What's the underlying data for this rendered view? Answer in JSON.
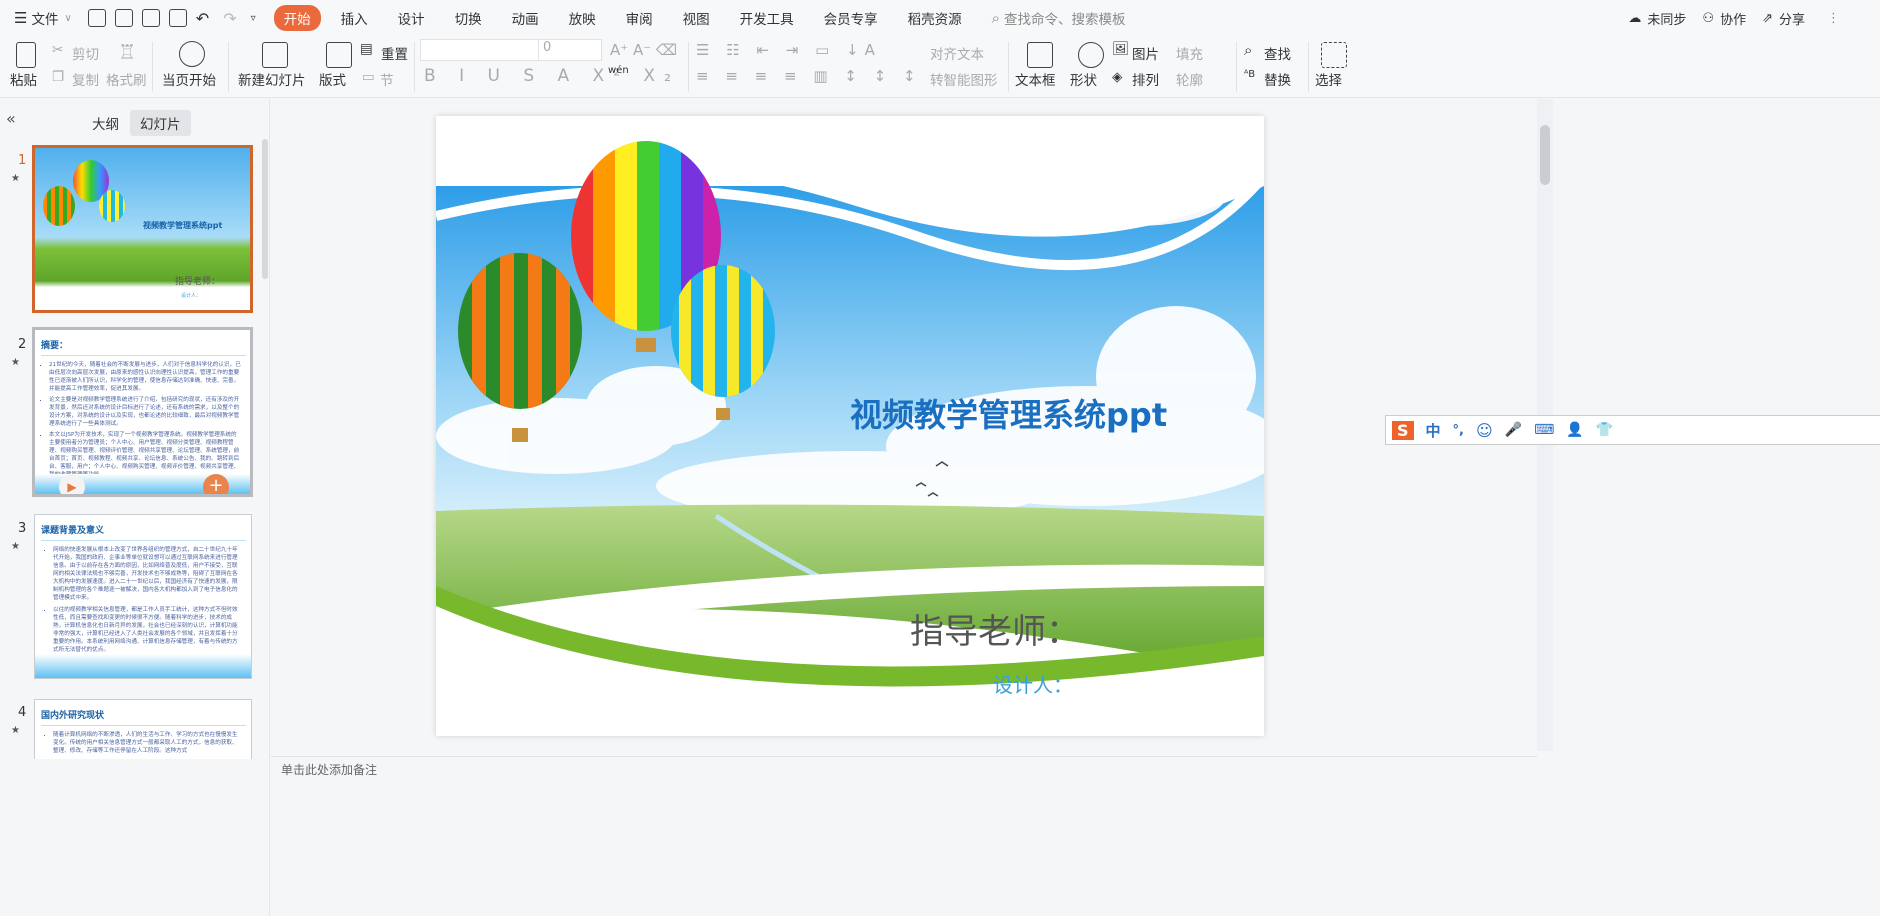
{
  "titlebar": {
    "file_menu": "文件",
    "tabs": [
      "开始",
      "插入",
      "设计",
      "切换",
      "动画",
      "放映",
      "审阅",
      "视图",
      "开发工具",
      "会员专享",
      "稻壳资源"
    ],
    "active_tab": "开始",
    "search_placeholder": "查找命令、搜索模板",
    "sync": "未同步",
    "collab": "协作",
    "share": "分享"
  },
  "ribbon": {
    "paste": "粘贴",
    "cut": "剪切",
    "copy": "复制",
    "format_painter": "格式刷",
    "play_from_current": "当页开始",
    "new_slide": "新建幻灯片",
    "layout": "版式",
    "reset": "重置",
    "section": "节",
    "font_name": "",
    "font_size": "0",
    "align_text": "对齐文本",
    "smart_art": "转智能图形",
    "textbox": "文本框",
    "shape": "形状",
    "picture": "图片",
    "fill": "填充",
    "arrange": "排列",
    "outline": "轮廓",
    "find": "查找",
    "replace": "替换",
    "select": "选择",
    "pinyin": "wén"
  },
  "panel": {
    "tab_outline": "大纲",
    "tab_slides": "幻灯片",
    "active": "幻灯片"
  },
  "thumbnails": [
    {
      "num": "1",
      "title": "视频教学管理系统ppt",
      "teacher": "指导老师：",
      "designer": "设计人："
    },
    {
      "num": "2",
      "title": "摘要：",
      "bullets": [
        "21世纪的今天，随着社会的不断发展与进步，人们对于信息科学化的认识，已由低层次向高层次发展，由原来的感性认识向理性认识提高，管理工作的重要性已逐渐被人们所认识，科学化的管理，使信息存储达到准确、快速、完善，并能提高工作管理效率，促进其发展。",
        "论文主要是对视频教学管理系统进行了介绍，包括研究的现状，还有涉及的开发背景，然后还对系统的设计目标进行了论述，还有系统的需求，以及整个的设计方案，对系统的设计以及实现，也都论述的比较细致，最后对视频教学管理系统进行了一些具体测试。",
        "本文以JSP为开发技术，实现了一个视频教学管理系统。视频教学管理系统的主要使用者分为管理员；个人中心、用户管理、视频分类管理、视频教程管理、视频购买管理、视频评价管理、视频共享管理、论坛管理、系统管理，前台首页；首页、视频教程、视频共享、论坛信息、系统公告、我的、跳转到后台、客服，用户；个人中心、视频购买管理、视频评价管理、视频共享管理、我的收藏管理等功能。"
      ]
    },
    {
      "num": "3",
      "title": "课题背景及意义",
      "bullets": [
        "网络的快速发展从根本上改变了世界各组织的管理方式，自二十世纪九十年代开始，我国的政府、企事业等单位就设想可以通过互联网系统来进行管理信息。由于以前存在各方面的原因，比如网络普及度低，用户不接受，互联网的相关法律法规也不够完善，开发技术也不够成熟等，阻碍了互联网在各大机构中的发展速度。进入二十一世纪以后，我国经济有了快速的发展，限制机构管理的各个难题逐一被解决，国内各大机构都加入到了电子信息化的管理模式中来。",
        "以往的视频教学相关信息管理，都是工作人员手工统计，这种方式不但时效性低，而且需要查找和变更的时候很不方便。随着科学的进步，技术的成熟，计算机信息化也日新月异的发展，社会也已经深刻的认识，计算机功能非常的强大，计算机已经进入了人类社会发展的各个领域，并且发挥着十分重要的作用。本系统利用网络沟通、计算机信息存储管理，有着与传统的方式所无法替代的优点。"
      ]
    },
    {
      "num": "4",
      "title": "国内外研究现状",
      "bullets": [
        "随着计算机网络的不断渗透，人们的生活与工作、学习的方式也在慢慢发生变化。传统的用户相关信息管理方式一般都采取人工的方式，信息的获取、整理、修改、存储等工作还停留在人工阶段。这种方式"
      ]
    }
  ],
  "slide": {
    "title": "视频教学管理系统ppt",
    "teacher": "指导老师：",
    "designer": "设计人："
  },
  "notes": {
    "placeholder": "单击此处添加备注"
  },
  "ime": {
    "mode": "中",
    "punct": "°,"
  },
  "colors": {
    "accent": "#ea6a3e",
    "title_blue": "#1a6fc0",
    "designer_blue": "#3aa0d8"
  }
}
